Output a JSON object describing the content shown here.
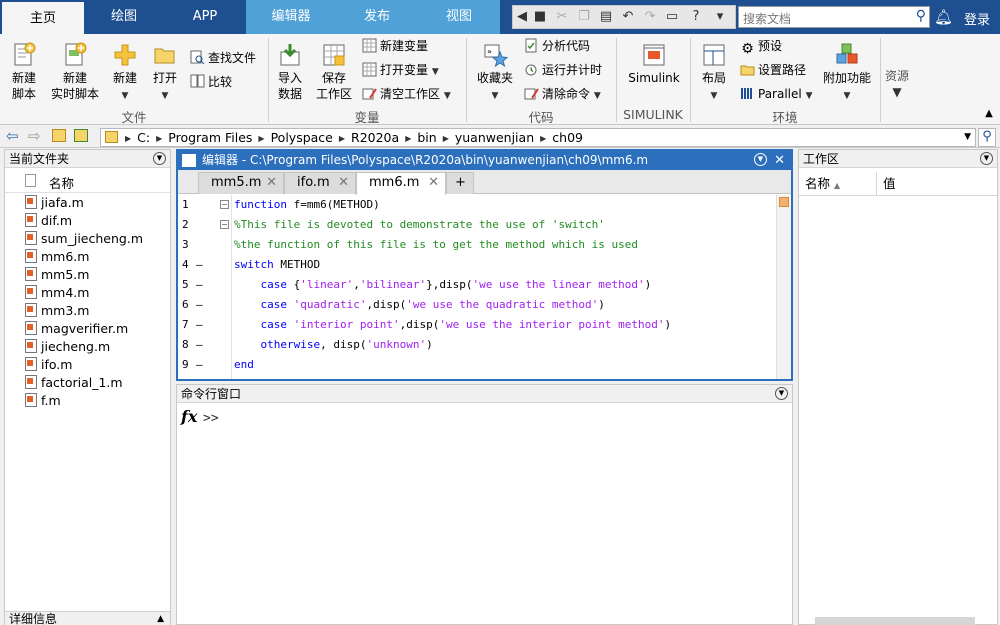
{
  "tabs": [
    "主页",
    "绘图",
    "APP",
    "编辑器",
    "发布",
    "视图"
  ],
  "search": {
    "placeholder": "搜索文档"
  },
  "login": "登录",
  "ribbon": {
    "file": {
      "new_script": [
        "新建",
        "脚本"
      ],
      "new_live_script": [
        "新建",
        "实时脚本"
      ],
      "new": "新建",
      "open": "打开",
      "find_files": "查找文件",
      "compare": "比较",
      "group_label": "文件"
    },
    "variable": {
      "import": [
        "导入",
        "数据"
      ],
      "save_workspace": [
        "保存",
        "工作区"
      ],
      "new_variable": "新建变量",
      "open_variable": "打开变量",
      "clear_workspace": "清空工作区",
      "group_label": "变量"
    },
    "code": {
      "favorites": "收藏夹",
      "analyze": "分析代码",
      "run_time": "运行并计时",
      "clear_commands": "清除命令",
      "group_label": "代码"
    },
    "simulink": {
      "label": "Simulink",
      "group_label": "SIMULINK"
    },
    "environment": {
      "layout": "布局",
      "preferences": "预设",
      "set_path": "设置路径",
      "parallel": "Parallel",
      "addons": "附加功能",
      "group_label": "环境"
    },
    "resources": "资源"
  },
  "path": [
    "C:",
    "Program Files",
    "Polyspace",
    "R2020a",
    "bin",
    "yuanwenjian",
    "ch09"
  ],
  "left_panel": {
    "title": "当前文件夹",
    "column": "名称",
    "files": [
      "jiafa.m",
      "dif.m",
      "sum_jiecheng.m",
      "mm6.m",
      "mm5.m",
      "mm4.m",
      "mm3.m",
      "magverifier.m",
      "jiecheng.m",
      "ifo.m",
      "factorial_1.m",
      "f.m"
    ],
    "details": "详细信息"
  },
  "editor": {
    "title": "编辑器 - C:\\Program Files\\Polyspace\\R2020a\\bin\\yuanwenjian\\ch09\\mm6.m",
    "tabs": [
      "mm5.m",
      "ifo.m",
      "mm6.m"
    ],
    "add_tab": "+",
    "lines": [
      {
        "n": "1",
        "dash": "",
        "parts": [
          [
            "kw",
            "function"
          ],
          [
            "",
            " f=mm6(METHOD)"
          ]
        ]
      },
      {
        "n": "2",
        "dash": "",
        "parts": [
          [
            "cm",
            "%This file is devoted to demonstrate the use of 'switch'"
          ]
        ]
      },
      {
        "n": "3",
        "dash": "",
        "parts": [
          [
            "cm",
            "%the function of this file is to get the method which is used"
          ]
        ]
      },
      {
        "n": "4",
        "dash": "–",
        "parts": [
          [
            "kw",
            "switch"
          ],
          [
            "",
            " METHOD"
          ]
        ]
      },
      {
        "n": "5",
        "dash": "–",
        "parts": [
          [
            "",
            "    "
          ],
          [
            "kw",
            "case"
          ],
          [
            "",
            " {"
          ],
          [
            "st",
            "'linear'"
          ],
          [
            "",
            ","
          ],
          [
            "st",
            "'bilinear'"
          ],
          [
            "",
            "},disp("
          ],
          [
            "st",
            "'we use the linear method'"
          ],
          [
            "",
            ")"
          ]
        ]
      },
      {
        "n": "6",
        "dash": "–",
        "parts": [
          [
            "",
            "    "
          ],
          [
            "kw",
            "case"
          ],
          [
            "",
            " "
          ],
          [
            "st",
            "'quadratic'"
          ],
          [
            "",
            ",disp("
          ],
          [
            "st",
            "'we use the quadratic method'"
          ],
          [
            "",
            ")"
          ]
        ]
      },
      {
        "n": "7",
        "dash": "–",
        "parts": [
          [
            "",
            "    "
          ],
          [
            "kw",
            "case"
          ],
          [
            "",
            " "
          ],
          [
            "st",
            "'interior point'"
          ],
          [
            "",
            ",disp("
          ],
          [
            "st",
            "'we use the interior point method'"
          ],
          [
            "",
            ")"
          ]
        ]
      },
      {
        "n": "8",
        "dash": "–",
        "parts": [
          [
            "",
            "    "
          ],
          [
            "kw",
            "otherwise"
          ],
          [
            "",
            ", disp("
          ],
          [
            "st",
            "'unknown'"
          ],
          [
            "",
            ")"
          ]
        ]
      },
      {
        "n": "9",
        "dash": "–",
        "parts": [
          [
            "kw",
            "end"
          ]
        ]
      }
    ]
  },
  "command": {
    "title": "命令行窗口",
    "fx": "fx",
    "prompt": ">>"
  },
  "workspace": {
    "title": "工作区",
    "col_name": "名称",
    "col_value": "值"
  }
}
